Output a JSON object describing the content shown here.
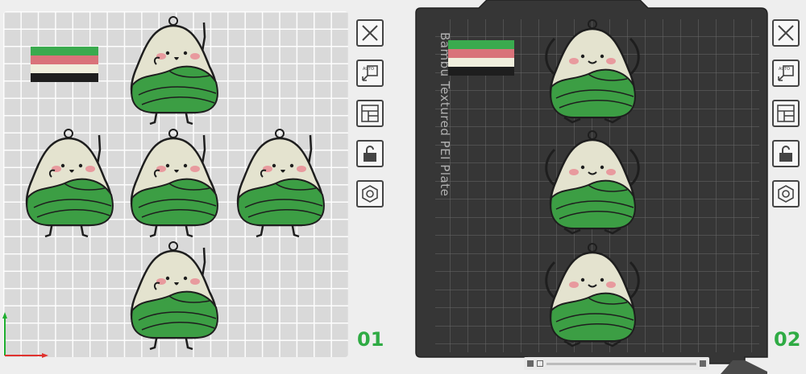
{
  "plates": [
    {
      "number": "01"
    },
    {
      "number": "02",
      "plate_text": "Bambu Textured PEI Plate"
    }
  ],
  "toolbar_icons": [
    "close-icon",
    "auto-orient-icon",
    "arrange-icon",
    "unlock-icon",
    "settings-icon"
  ],
  "flag_colors": [
    "#3aaa4e",
    "#d9737a",
    "#efeedd",
    "#1e1e1e"
  ],
  "colors": {
    "plate1_bg": "#d9d9d9",
    "plate2_bg": "#3a3a3a",
    "accent_green": "#2fab44",
    "dumpling_green": "#3c9e44",
    "dumpling_cream": "#e4e3cf",
    "blush": "#e89a9e"
  }
}
